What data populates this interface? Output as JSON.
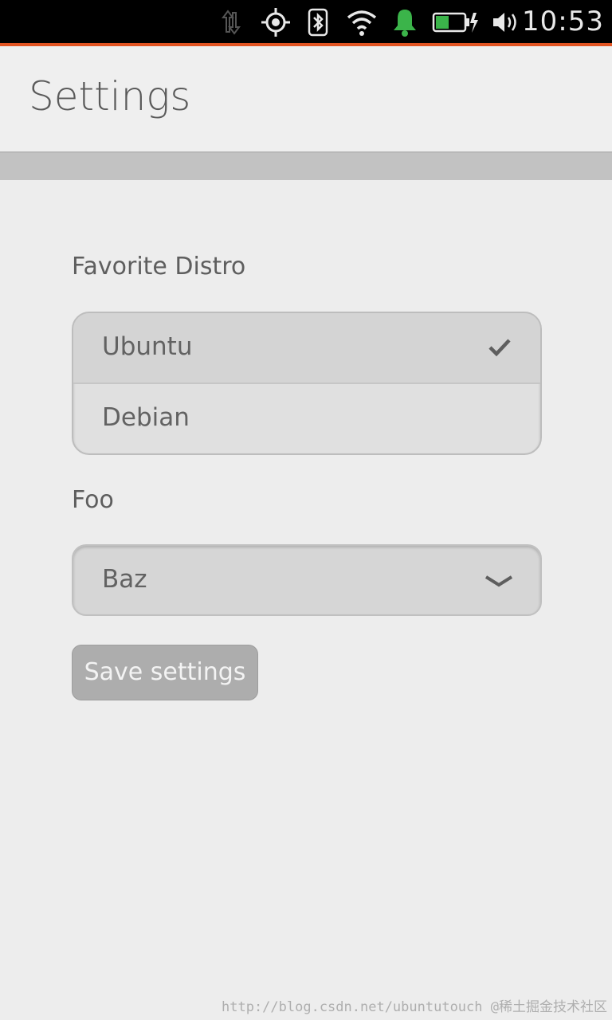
{
  "status_bar": {
    "time": "10:53",
    "icons": [
      "data-transfer-icon",
      "location-icon",
      "bluetooth-icon",
      "wifi-icon",
      "notification-bell-icon",
      "battery-charging-icon",
      "volume-icon"
    ],
    "bell_color": "#3bb44a",
    "accent_color": "#e25422"
  },
  "header": {
    "title": "Settings"
  },
  "distro": {
    "label": "Favorite Distro",
    "options": [
      {
        "label": "Ubuntu",
        "selected": true
      },
      {
        "label": "Debian",
        "selected": false
      }
    ]
  },
  "foo": {
    "label": "Foo",
    "value": "Baz"
  },
  "actions": {
    "save_label": "Save settings"
  },
  "watermark": {
    "text": "http://blog.csdn.net/ubuntutouch @稀土掘金技术社区"
  }
}
